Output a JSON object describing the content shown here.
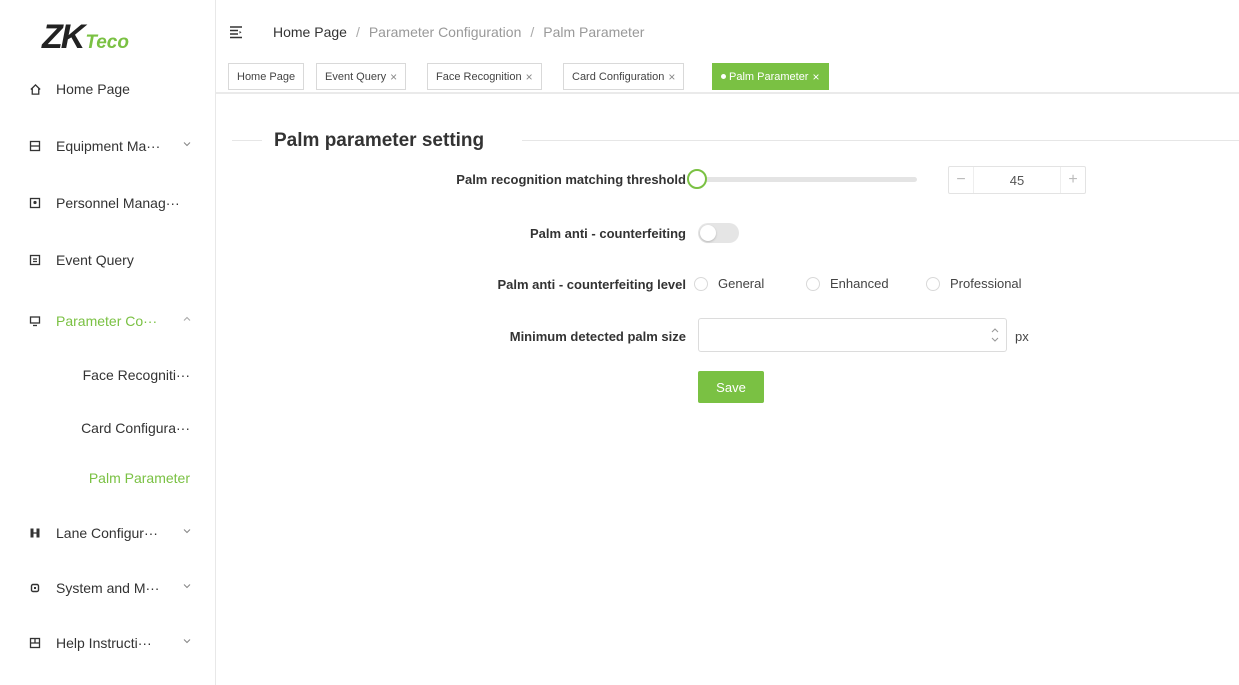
{
  "brand": {
    "logo_main": "ZK",
    "logo_sub": "Teco",
    "accent_color": "#7ac143"
  },
  "sidebar": {
    "items": [
      {
        "label": "Home Page",
        "icon": "home-icon"
      },
      {
        "label": "Equipment Ma···",
        "icon": "equipment-icon",
        "chevron": "down"
      },
      {
        "label": "Personnel Manag···",
        "icon": "personnel-icon"
      },
      {
        "label": "Event Query",
        "icon": "event-icon"
      },
      {
        "label": "Parameter Co···",
        "icon": "parameter-icon",
        "chevron": "up",
        "active": true
      },
      {
        "label": "Lane Configur···",
        "icon": "lane-icon",
        "chevron": "down"
      },
      {
        "label": "System and M···",
        "icon": "system-icon",
        "chevron": "down"
      },
      {
        "label": "Help Instructi···",
        "icon": "help-icon",
        "chevron": "down"
      }
    ],
    "sub_items": [
      {
        "label": "Face Recogniti···"
      },
      {
        "label": "Card Configura···"
      },
      {
        "label": "Palm Parameter",
        "active": true
      }
    ]
  },
  "header": {
    "breadcrumb": [
      "Home Page",
      "Parameter Configuration",
      "Palm Parameter"
    ],
    "breadcrumb_separator": "/"
  },
  "tabs": [
    {
      "label": "Home Page",
      "closable": false
    },
    {
      "label": "Event Query",
      "closable": true
    },
    {
      "label": "Face Recognition",
      "closable": true
    },
    {
      "label": "Card Configuration",
      "closable": true
    },
    {
      "label": "Palm Parameter",
      "closable": true,
      "active": true
    }
  ],
  "tab_close_glyph": "×",
  "form": {
    "section_title": "Palm parameter setting",
    "threshold": {
      "label": "Palm recognition matching threshold",
      "value": "45",
      "minus": "−",
      "plus": "+",
      "slider_fraction": 0
    },
    "anti_counterfeit": {
      "label": "Palm anti - counterfeiting",
      "enabled": false
    },
    "level": {
      "label": "Palm anti - counterfeiting level",
      "options": [
        "General",
        "Enhanced",
        "Professional"
      ],
      "selected": null
    },
    "min_size": {
      "label": "Minimum detected palm size",
      "value": "",
      "unit": "px"
    },
    "save_label": "Save"
  }
}
